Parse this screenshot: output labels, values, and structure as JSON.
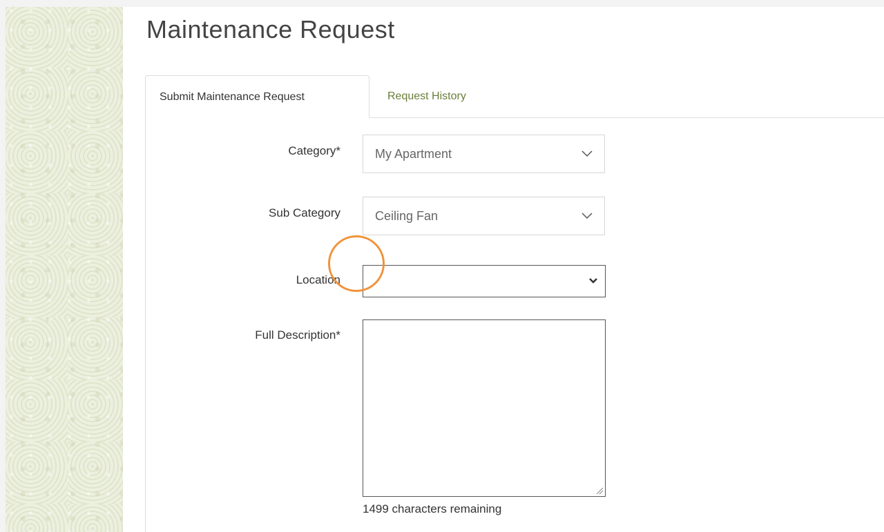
{
  "page": {
    "title": "Maintenance Request"
  },
  "tabs": [
    {
      "label": "Submit Maintenance Request",
      "active": true
    },
    {
      "label": "Request History",
      "active": false
    }
  ],
  "form": {
    "category": {
      "label": "Category*",
      "value": "My Apartment",
      "icon": "chevron-down-icon"
    },
    "sub_category": {
      "label": "Sub Category",
      "value": "Ceiling Fan",
      "icon": "chevron-down-icon"
    },
    "location": {
      "label": "Location",
      "value": "",
      "icon": "chevron-down-icon"
    },
    "description": {
      "label": "Full Description*",
      "value": "",
      "chars_remaining_text": "1499 characters remaining"
    }
  },
  "colors": {
    "tab_link": "#6b7d3a",
    "click_indicator": "#f0933b",
    "sidebar_background": "#eaeedc"
  }
}
